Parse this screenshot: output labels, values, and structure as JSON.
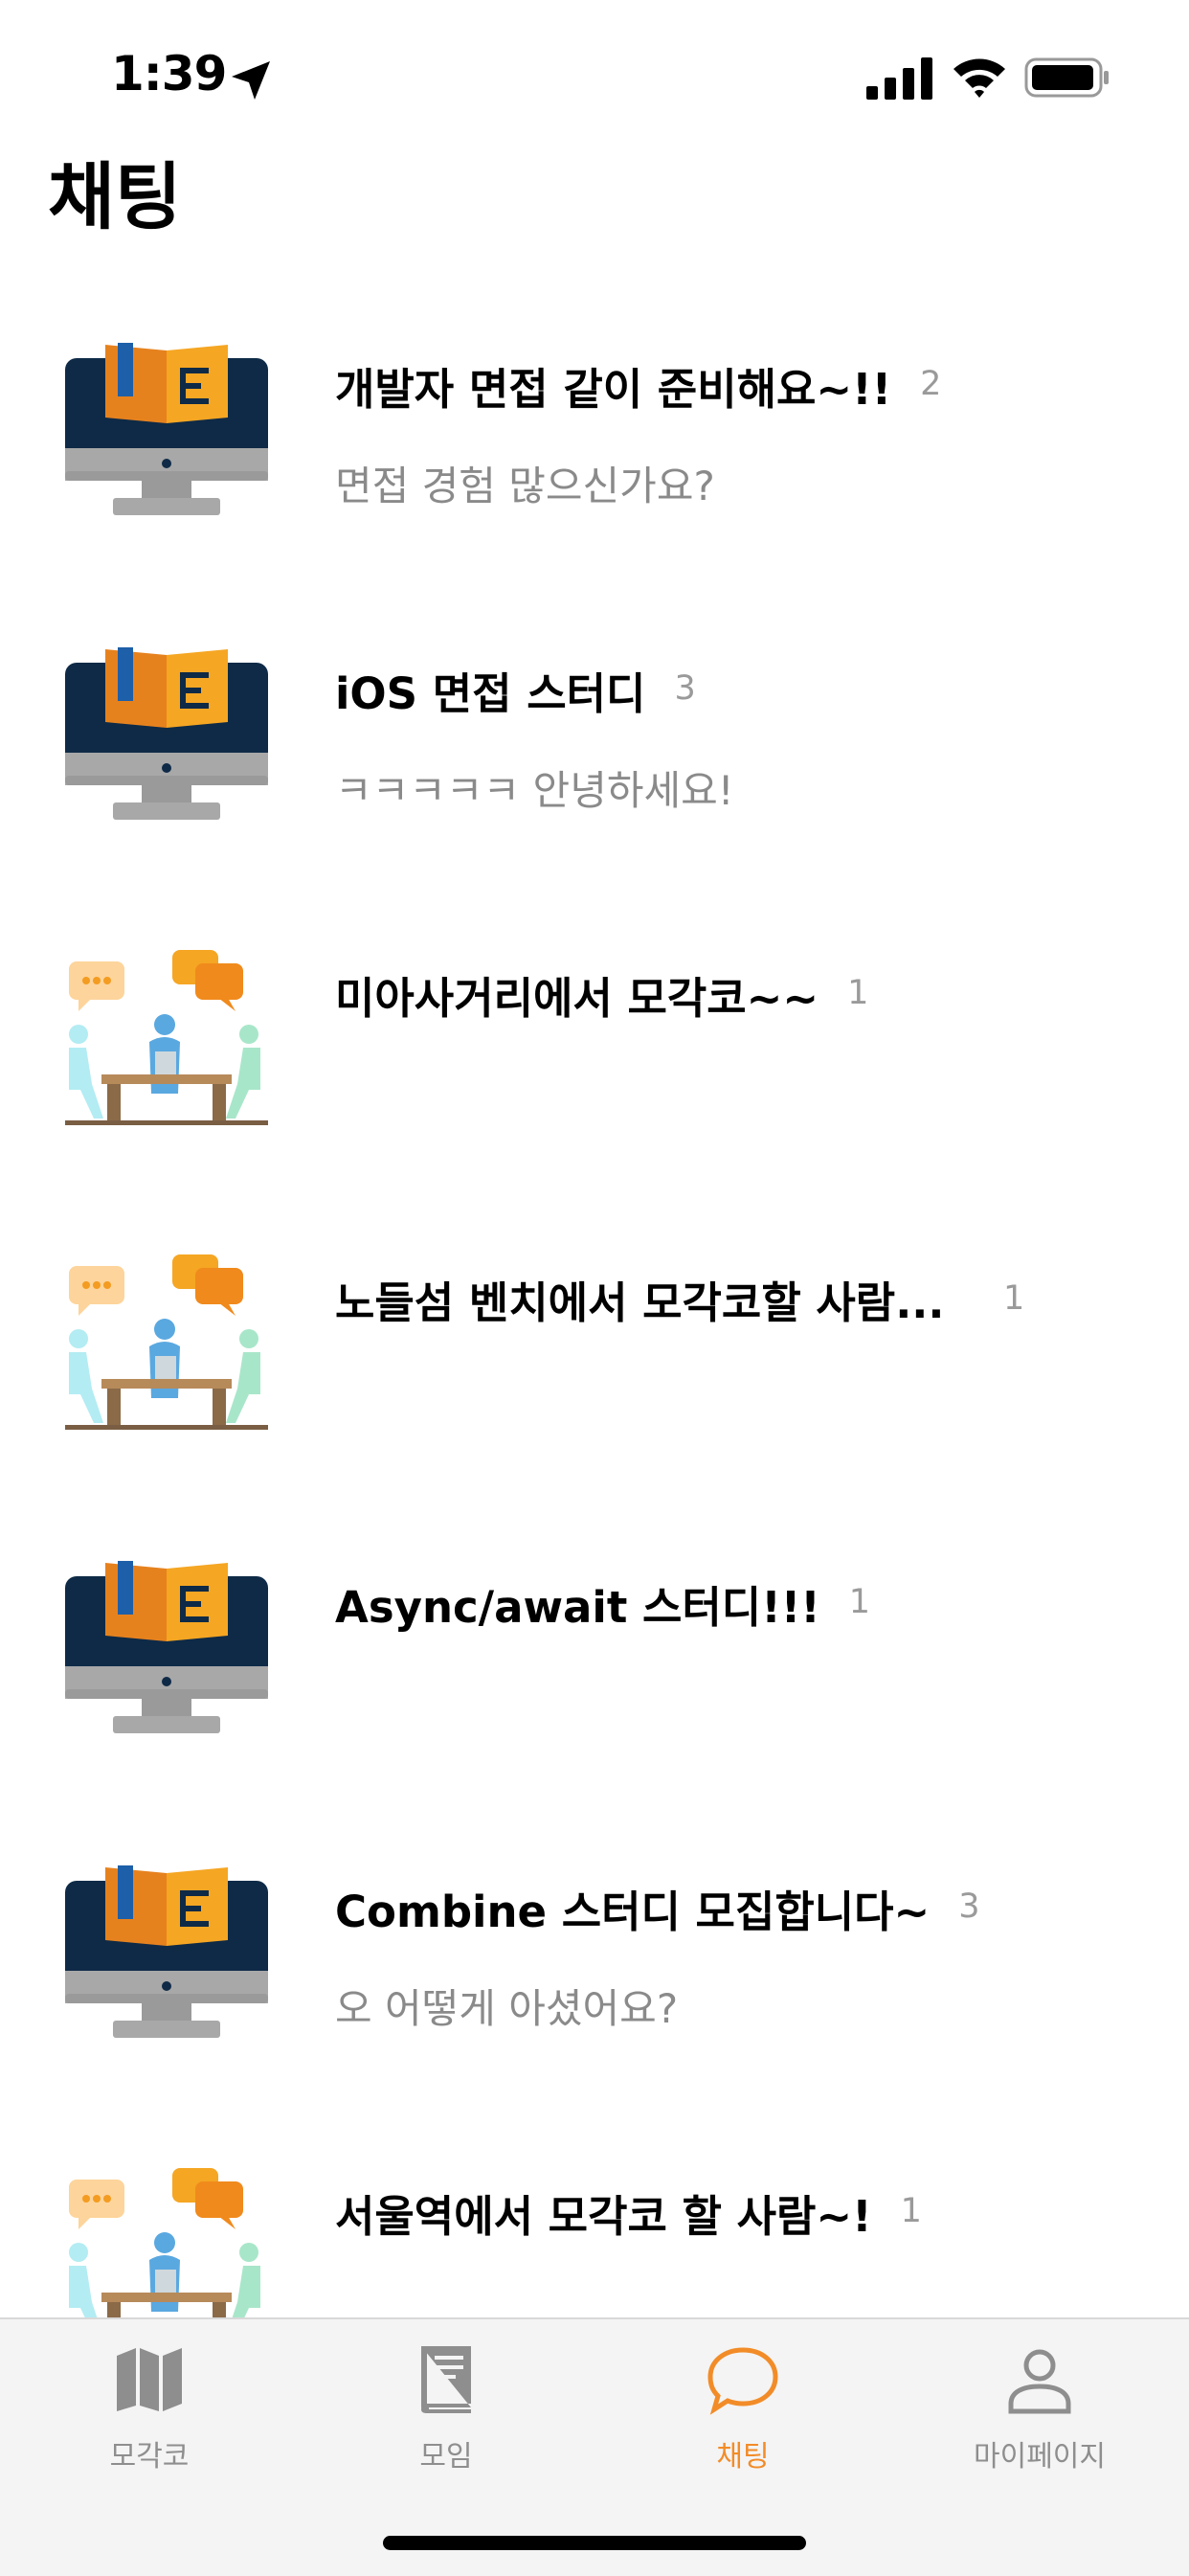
{
  "status_bar": {
    "time": "1:39",
    "icons": [
      "location-arrow-icon",
      "cellular-signal-icon",
      "wifi-icon",
      "battery-icon"
    ]
  },
  "header": {
    "title": "채팅"
  },
  "chats": [
    {
      "name": "개발자 면접 같이 준비해요~!!",
      "count": "2",
      "last_message": "면접 경험 많으신가요?",
      "thumb": "computer-book-icon"
    },
    {
      "name": "iOS 면접 스터디",
      "count": "3",
      "last_message": "ㅋㅋㅋㅋㅋ 안녕하세요!",
      "thumb": "computer-book-icon"
    },
    {
      "name": "미아사거리에서 모각코~~",
      "count": "1",
      "last_message": "",
      "thumb": "meeting-table-icon"
    },
    {
      "name": "노들섬 벤치에서 모각코할 사람...",
      "count": "1",
      "last_message": "",
      "thumb": "meeting-table-icon"
    },
    {
      "name": "Async/await 스터디!!!",
      "count": "1",
      "last_message": "",
      "thumb": "computer-book-icon"
    },
    {
      "name": "Combine 스터디 모집합니다~",
      "count": "3",
      "last_message": "오 어떻게 아셨어요?",
      "thumb": "computer-book-icon"
    },
    {
      "name": "서울역에서 모각코 할 사람~!",
      "count": "1",
      "last_message": "",
      "thumb": "meeting-table-icon"
    }
  ],
  "tabs": [
    {
      "label": "모각코",
      "icon": "map-icon",
      "active": false
    },
    {
      "label": "모임",
      "icon": "book-icon",
      "active": false
    },
    {
      "label": "채팅",
      "icon": "chat-bubble-icon",
      "active": true
    },
    {
      "label": "마이페이지",
      "icon": "person-icon",
      "active": false
    }
  ],
  "colors": {
    "accent": "#f28c28",
    "inactive": "#8e8e8e",
    "tab_bar_bg": "#f4f4f4"
  }
}
